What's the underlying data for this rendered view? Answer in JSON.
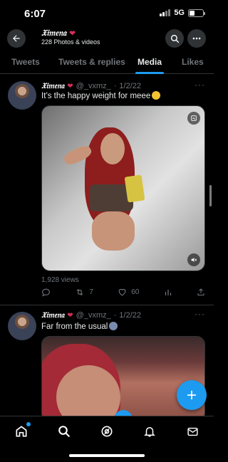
{
  "status_bar": {
    "time": "6:07",
    "network": "5G"
  },
  "header": {
    "name": "𝔛𝔦𝔪𝔢𝔫𝔞",
    "heart": "❤",
    "subtitle": "228 Photos & videos"
  },
  "tabs": [
    {
      "label": "Tweets"
    },
    {
      "label": "Tweets & replies"
    },
    {
      "label": "Media",
      "active": true
    },
    {
      "label": "Likes"
    }
  ],
  "tweets": [
    {
      "name": "𝔛𝔦𝔪𝔢𝔫𝔞",
      "heart": "❤",
      "handle": "@_vxmz_",
      "date": "1/2/22",
      "text": "It’s the happy weight for meee",
      "emoji": "pleading-face",
      "views": "1,928 views",
      "retweets": "7",
      "likes": "60"
    },
    {
      "name": "𝔛𝔦𝔪𝔢𝔫𝔞",
      "heart": "❤",
      "handle": "@_vxmz_",
      "date": "1/2/22",
      "text": "Far from the usual",
      "emoji": "speaking-head"
    }
  ],
  "colors": {
    "accent": "#1d9bf0",
    "background": "#000000",
    "muted": "#71767b",
    "text": "#e7e9ea"
  },
  "icons": [
    "back-arrow-icon",
    "search-icon",
    "more-icon",
    "reply-icon",
    "retweet-icon",
    "like-icon",
    "analytics-icon",
    "share-icon",
    "compose-icon",
    "home-icon",
    "explore-icon",
    "spaces-icon",
    "notifications-icon",
    "messages-icon"
  ]
}
